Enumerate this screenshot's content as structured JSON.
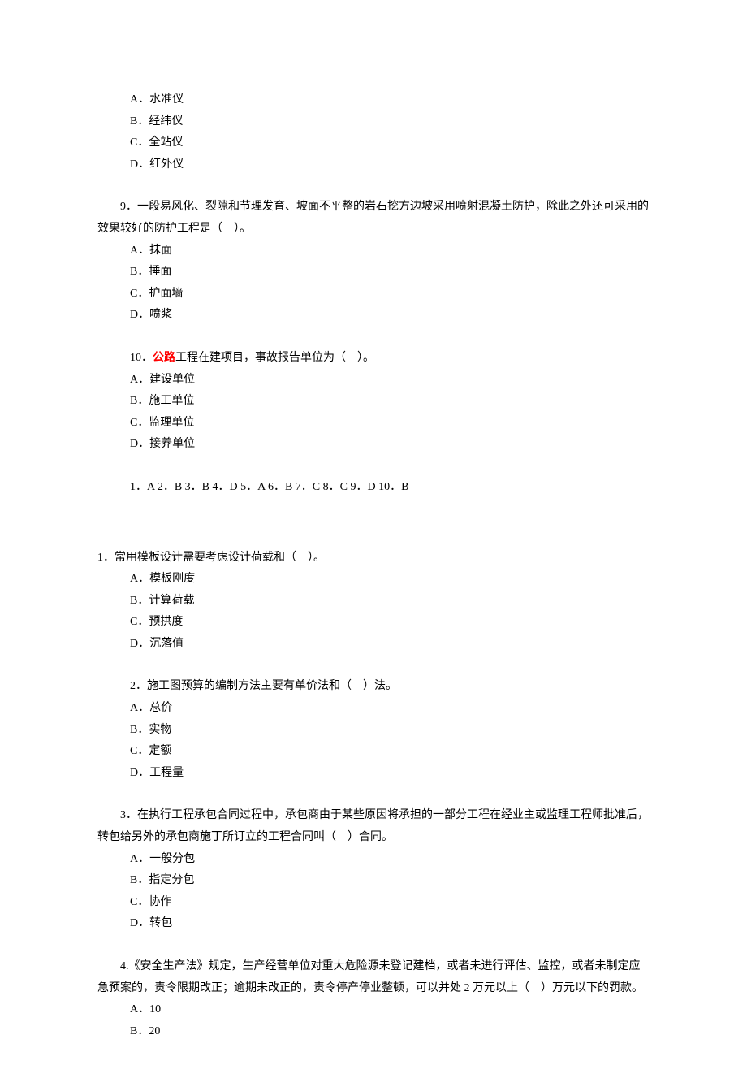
{
  "q8_options": {
    "a": "A．水准仪",
    "b": "B．经纬仪",
    "c": "C．全站仪",
    "d": "D．红外仪"
  },
  "q9": {
    "text": "9．一段易风化、裂隙和节理发育、坡面不平整的岩石挖方边坡采用喷射混凝土防护，除此之外还可采用的效果较好的防护工程是（　）。",
    "a": "A．抹面",
    "b": "B．捶面",
    "c": "C．护面墙",
    "d": "D．喷浆"
  },
  "q10": {
    "prefix": "10．",
    "highlight": "公路",
    "suffix": "工程在建项目，事故报告单位为（　）。",
    "a": "A．建设单位",
    "b": "B．施工单位",
    "c": "C．监理单位",
    "d": "D．接养单位"
  },
  "answers": "1．A 2．B 3．B 4．D 5．A 6．B 7．C 8．C 9．D 10．B",
  "sec2": {
    "q1": {
      "text": "1．常用模板设计需要考虑设计荷载和（　）。",
      "a": "A．模板刚度",
      "b": "B．计算荷载",
      "c": "C．预拱度",
      "d": "D．沉落值"
    },
    "q2": {
      "text": "2．施工图预算的编制方法主要有单价法和（　）法。",
      "a": "A．总价",
      "b": "B．实物",
      "c": "C．定额",
      "d": "D．工程量"
    },
    "q3": {
      "text": "3．在执行工程承包合同过程中，承包商由于某些原因将承担的一部分工程在经业主或监理工程师批准后，转包给另外的承包商施丁所订立的工程合同叫（　）合同。",
      "a": "A．一般分包",
      "b": "B．指定分包",
      "c": "C．协作",
      "d": "D．转包"
    },
    "q4": {
      "text": "4.《安全生产法》规定，生产经营单位对重大危险源未登记建档，或者未进行评估、监控，或者未制定应急预案的，责令限期改正；逾期未改正的，责令停产停业整顿，可以并处 2 万元以上（　）万元以下的罚款。",
      "a": "A．10",
      "b": "B．20"
    }
  }
}
